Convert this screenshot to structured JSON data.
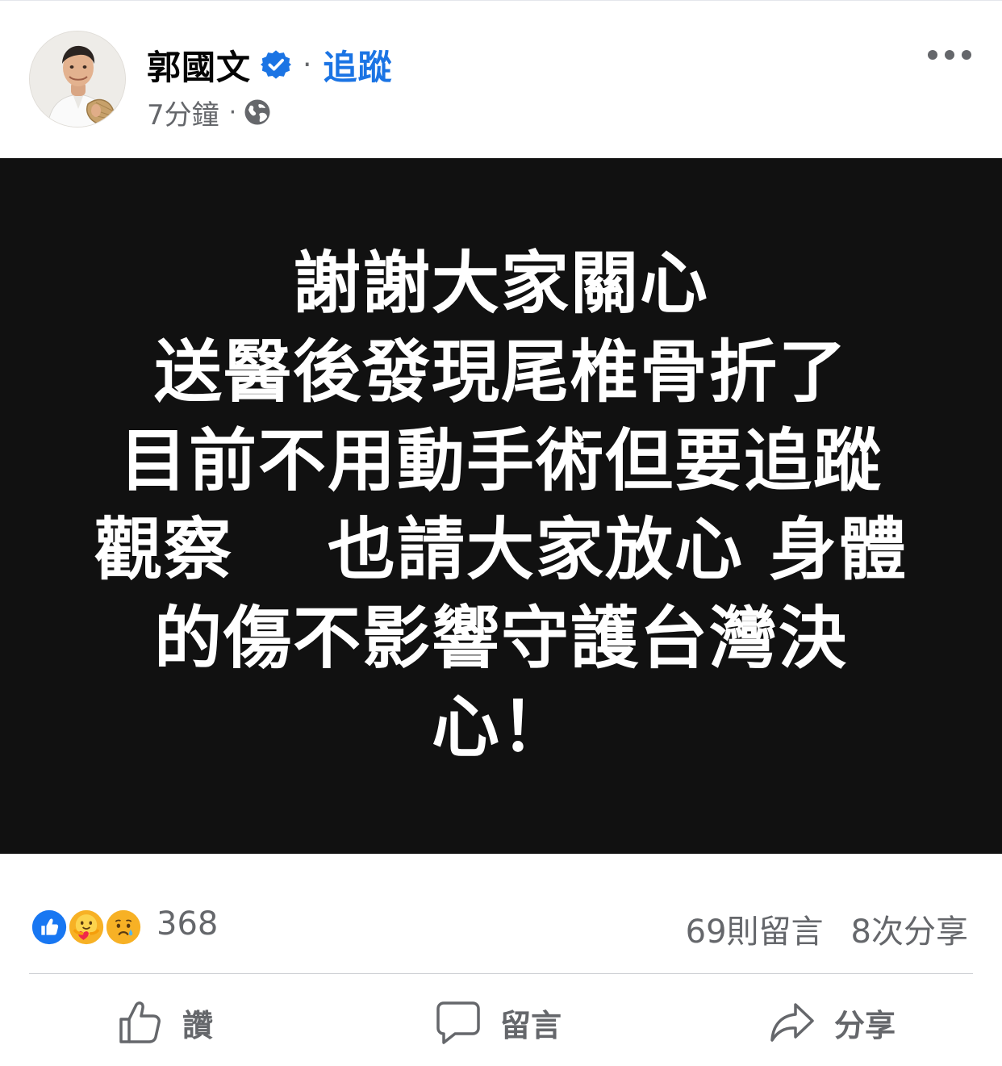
{
  "author": {
    "name": "郭國文",
    "follow_label": "追蹤",
    "separator": "·",
    "timestamp": "7分鐘",
    "meta_separator": "·",
    "audience_icon": "globe-icon",
    "verified_icon": "verified-badge-icon"
  },
  "post": {
    "image_lines": [
      "謝謝大家關心",
      "送醫後發現尾椎骨折了",
      "目前不用動手術但要追蹤",
      "觀察　 也請大家放心 身體",
      "的傷不影響守護台灣決",
      "心！"
    ],
    "image_background": "#111111",
    "text_color": "#ffffff"
  },
  "engagement": {
    "reactions": [
      "like-reaction-icon",
      "care-reaction-icon",
      "sad-reaction-icon"
    ],
    "reaction_count": "368",
    "comments": "69則留言",
    "shares": "8次分享"
  },
  "actions": {
    "like_label": "讚",
    "comment_label": "留言",
    "share_label": "分享"
  },
  "colors": {
    "accent": "#1b74e4",
    "secondary_text": "#65676b"
  }
}
